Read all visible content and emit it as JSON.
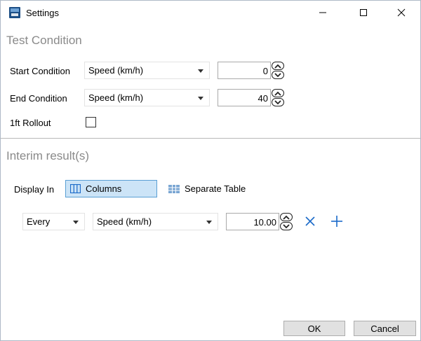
{
  "window": {
    "title": "Settings",
    "icon": "app-logo-icon",
    "controls": [
      "minimize-icon",
      "maximize-icon",
      "close-icon"
    ]
  },
  "test_condition": {
    "heading": "Test Condition",
    "start": {
      "label": "Start Condition",
      "type": "Speed (km/h)",
      "value": "0"
    },
    "end": {
      "label": "End Condition",
      "type": "Speed (km/h)",
      "value": "40"
    },
    "rollout": {
      "label": "1ft Rollout",
      "checked": false
    }
  },
  "interim": {
    "heading": "Interim result(s)",
    "display_in_label": "Display In",
    "options": [
      {
        "label": "Columns",
        "icon": "columns-icon",
        "selected": true
      },
      {
        "label": "Separate Table",
        "icon": "table-icon",
        "selected": false
      }
    ],
    "row": {
      "frequency": "Every",
      "type": "Speed (km/h)",
      "value": "10.00"
    },
    "actions": [
      "remove-icon",
      "add-icon"
    ]
  },
  "footer": {
    "ok": "OK",
    "cancel": "Cancel"
  },
  "colors": {
    "accent": "#1b6ac9",
    "selected_bg": "#cce4f7",
    "section_title": "#8a8a8a"
  }
}
